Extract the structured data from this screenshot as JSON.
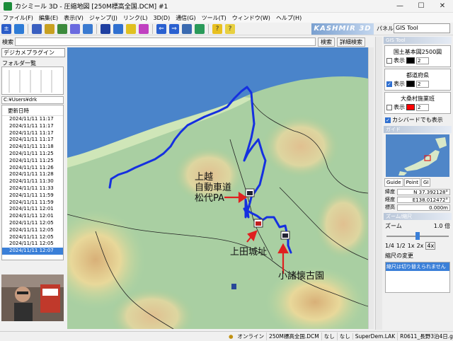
{
  "window": {
    "title": "カシミール 3D - 圧縮地図 [250M標高全国.DCM] #1",
    "minimize_glyph": "—",
    "maximize_glyph": "☐",
    "close_glyph": "✕"
  },
  "menu": [
    "ファイル(F)",
    "編集(E)",
    "表示(V)",
    "ジャンプ(J)",
    "リンク(L)",
    "3D(D)",
    "通信(G)",
    "ツール(T)",
    "ウィンドウ(W)",
    "ヘルプ(H)"
  ],
  "toolbar": {
    "brand": "KASHMIR 3D",
    "panel_label": "パネル",
    "panel_value": "GIS Tool"
  },
  "search": {
    "label": "検索",
    "placeholder": "",
    "button": "検索",
    "detail_button": "詳細検索"
  },
  "left": {
    "plugin": "デジカメプラグイン",
    "folder_title": "フォルダ一覧",
    "path": "C:¥Users¥drk",
    "list_header": "更新日時",
    "items": [
      "2024/11/11 11:17",
      "2024/11/11 11:17",
      "2024/11/11 11:17",
      "2024/11/11 11:17",
      "2024/11/11 11:18",
      "2024/11/11 11:25",
      "2024/11/11 11:25",
      "2024/11/11 11:26",
      "2024/11/11 11:28",
      "2024/11/11 11:30",
      "2024/11/11 11:33",
      "2024/11/11 11:59",
      "2024/11/11 11:59",
      "2024/11/11 12:01",
      "2024/11/11 12:01",
      "2024/11/11 12:05",
      "2024/11/11 12:05",
      "2024/11/11 12:05",
      "2024/11/11 12:05",
      "2024/11/11 12:07"
    ],
    "selected_index": 19
  },
  "map": {
    "labels": {
      "pa_line1": "上越",
      "pa_line2": "自動車道",
      "pa_line3": "松代PA",
      "castle": "上田城址",
      "park": "小諸懐古園"
    },
    "track_color": "#1530e0",
    "arrow_color": "#e02020"
  },
  "right": {
    "header": "GIS Tool",
    "layers": [
      {
        "title": "国土基本図2500図",
        "checked": false,
        "show": "表示",
        "color": "#000000",
        "width": "2"
      },
      {
        "title": "都道府県",
        "checked": true,
        "show": "表示",
        "color": "#000000",
        "width": "2"
      },
      {
        "title": "大桑村施業班",
        "checked": false,
        "show": "表示",
        "color": "#ff0000",
        "width": "2"
      }
    ],
    "cursor_option": "カシバードでも表示",
    "guide_header": "ガイド",
    "guide_tabs": [
      "Guide",
      "Point",
      "GI"
    ],
    "lat_label": "緯度",
    "lat_value": "N 37.392128°",
    "lon_label": "経度",
    "lon_value": "E138.012472°",
    "elev_label": "標高",
    "elev_value": "0.000m",
    "zoom_header": "ズーム/縮尺",
    "zoom_label": "ズーム",
    "zoom_value": "1.0 倍",
    "zoom_level": 0.5,
    "zoom_buttons": [
      "1/4",
      "1/2",
      "1x",
      "2x",
      "4x"
    ],
    "scale_header": "縮尺の変更",
    "scale_text": "縮尺は切り替えられません"
  },
  "status": {
    "online": "オンライン",
    "dcm": "250M標高全国.DCM",
    "f1": "なし",
    "f2": "なし",
    "lak": "SuperDem.LAK",
    "gdb": "R0611_長野3泊4日.gdb"
  }
}
